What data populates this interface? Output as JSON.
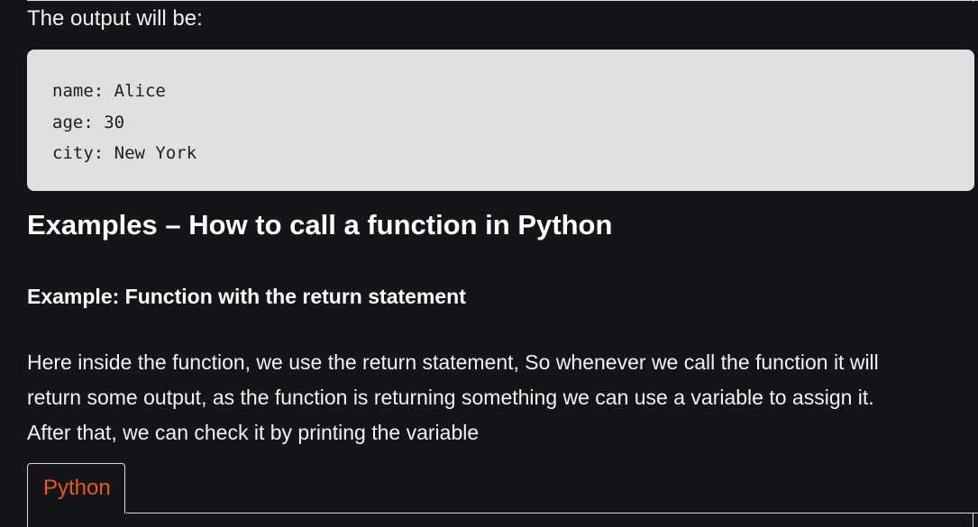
{
  "intro_text": "The output will be:",
  "output_block": {
    "lines": [
      "name: Alice",
      "age: 30",
      "city: New York"
    ]
  },
  "section_heading": "Examples – How to call a function in Python",
  "example_heading": "Example: Function with the return statement",
  "paragraph_lines": [
    "Here inside the function, we use the return statement, So whenever we call the function it will",
    "return some output, as the function is returning something we can use a variable to assign it.",
    "After that, we can check it by printing the variable"
  ],
  "code_tabs": [
    {
      "label": "Python",
      "active": true
    }
  ],
  "colors": {
    "background": "#141518",
    "output_background": "#e0e0e0",
    "tab_accent": "#e8591f",
    "text": "#f2f2f2"
  }
}
